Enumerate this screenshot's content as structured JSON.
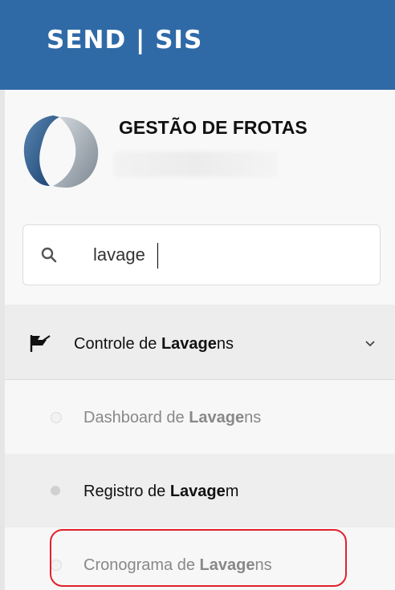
{
  "header": {
    "brand": "SEND | SIS"
  },
  "org": {
    "name": "GESTÃO DE FROTAS"
  },
  "search": {
    "value": "lavage",
    "icon": "search-icon"
  },
  "menu": {
    "parent": {
      "prefix": "Controle de ",
      "match": "Lavage",
      "suffix": "ns",
      "icon": "flag-icon",
      "expanded": true
    },
    "children": [
      {
        "prefix": "Dashboard de ",
        "match": "Lavage",
        "suffix": "ns"
      },
      {
        "prefix": "Registro de ",
        "match": "Lavage",
        "suffix": "m"
      },
      {
        "prefix": "Cronograma de ",
        "match": "Lavage",
        "suffix": "ns"
      }
    ]
  },
  "colors": {
    "header_bg": "#2f6aa7",
    "highlight": "#e2202b"
  }
}
